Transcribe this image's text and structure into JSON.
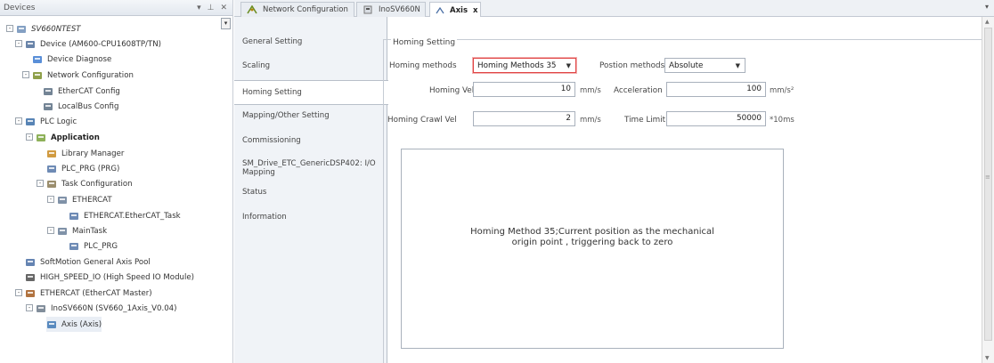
{
  "devices_panel": {
    "title": "Devices",
    "controls": [
      "▾",
      "⊥",
      "✕"
    ],
    "tree": [
      {
        "label": "SV660NTEST",
        "italic": true,
        "icon": "project-icon",
        "exp": "-"
      },
      {
        "label": "Device (AM600-CPU1608TP/TN)",
        "icon": "device-icon",
        "exp": "-"
      },
      {
        "label": "Device Diagnose",
        "icon": "diagnose-icon"
      },
      {
        "label": "Network Configuration",
        "icon": "network-icon",
        "exp": "-"
      },
      {
        "label": "EtherCAT Config",
        "icon": "config-icon"
      },
      {
        "label": "LocalBus Config",
        "icon": "config-icon"
      },
      {
        "label": "PLC Logic",
        "icon": "plc-icon",
        "exp": "-"
      },
      {
        "label": "Application",
        "bold": true,
        "icon": "application-icon",
        "exp": "-"
      },
      {
        "label": "Library Manager",
        "icon": "library-icon"
      },
      {
        "label": "PLC_PRG (PRG)",
        "icon": "program-icon"
      },
      {
        "label": "Task Configuration",
        "icon": "task-config-icon",
        "exp": "-"
      },
      {
        "label": "ETHERCAT",
        "icon": "task-icon",
        "exp": "-"
      },
      {
        "label": "ETHERCAT.EtherCAT_Task",
        "icon": "program-icon"
      },
      {
        "label": "MainTask",
        "icon": "task-icon",
        "exp": "-"
      },
      {
        "label": "PLC_PRG",
        "icon": "program-icon"
      },
      {
        "label": "SoftMotion General Axis Pool",
        "icon": "axis-pool-icon"
      },
      {
        "label": "HIGH_SPEED_IO (High Speed IO Module)",
        "icon": "module-icon"
      },
      {
        "label": "ETHERCAT (EtherCAT Master)",
        "icon": "master-icon",
        "exp": "-"
      },
      {
        "label": "InoSV660N (SV660_1Axis_V0.04)",
        "icon": "drive-icon",
        "exp": "-"
      },
      {
        "label": "Axis (Axis)",
        "icon": "axis-icon",
        "selected": true
      }
    ]
  },
  "tabs": [
    {
      "label": "Network Configuration",
      "icon": "network-icon"
    },
    {
      "label": "InoSV660N",
      "icon": "drive-icon"
    },
    {
      "label": "Axis",
      "icon": "axis-icon",
      "active": true,
      "close": "x"
    }
  ],
  "tab_dropdown": "▾",
  "side_tabs": [
    {
      "label": "General Setting"
    },
    {
      "label": "Scaling"
    },
    {
      "label": "Homing Setting",
      "active": true
    },
    {
      "label": "Mapping/Other Setting"
    },
    {
      "label": "Commissioning"
    },
    {
      "label": "SM_Drive_ETC_GenericDSP402: I/O Mapping"
    },
    {
      "label": "Status"
    },
    {
      "label": "Information"
    }
  ],
  "homing": {
    "group_title": "Homing Setting",
    "methods_label": "Homing methods",
    "methods_value": "Homing Methods 35",
    "position_label": "Postion methods",
    "position_value": "Absolute",
    "vel_label": "Homing Vel",
    "vel_value": "10",
    "vel_unit": "mm/s",
    "accel_label": "Acceleration",
    "accel_value": "100",
    "accel_unit": "mm/s²",
    "crawl_label": "Homing Crawl Vel",
    "crawl_value": "2",
    "crawl_unit": "mm/s",
    "time_label": "Time Limit",
    "time_value": "50000",
    "time_unit": "*10ms",
    "description_line1": "Homing Method 35;Current position as the mechanical",
    "description_line2": "origin point , triggering back to zero"
  },
  "colors": {
    "highlight": "#e04545"
  }
}
